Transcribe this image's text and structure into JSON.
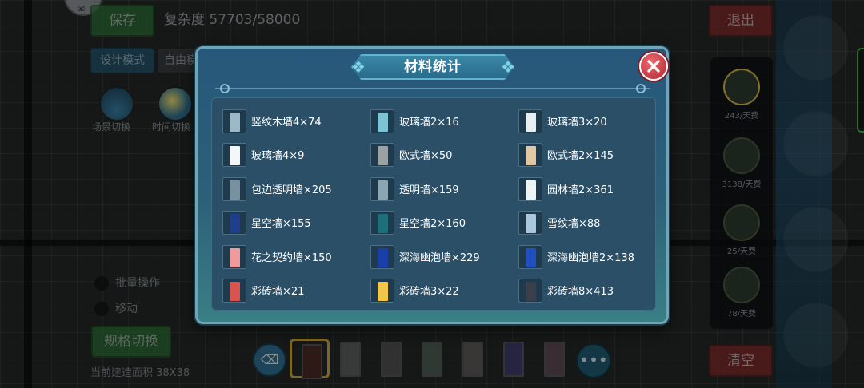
{
  "hud": {
    "save_label": "保存",
    "complexity_text": "复杂度 57703/58000",
    "design_mode_label": "设计模式",
    "free_mode_label": "自由模",
    "scene_switch_label": "场景切换",
    "time_switch_label": "时间切换",
    "batch_op_label": "批量操作",
    "move_label": "移动",
    "spec_switch_label": "规格切换",
    "area_text": "当前建造面积 38X38",
    "exit_label": "退出",
    "clear_label": "清空"
  },
  "side_panel": {
    "items": [
      {
        "label": "243/天费",
        "icon": "wall-tile-icon"
      },
      {
        "label": "3138/天费",
        "icon": "window-icon"
      },
      {
        "label": "25/天费",
        "icon": "door-icon"
      },
      {
        "label": "78/天费",
        "icon": "fence-icon"
      }
    ]
  },
  "toolbar": {
    "eraser_icon": "eraser-icon",
    "more_label": "•••",
    "doors": [
      {
        "color": "#4a2b24",
        "selected": true
      },
      {
        "color": "#5d5d5d",
        "selected": false
      },
      {
        "color": "#4f4f4f",
        "selected": false
      },
      {
        "color": "#4d5d55",
        "selected": false
      },
      {
        "color": "#5c5a58",
        "selected": false
      },
      {
        "color": "#3c3a6a",
        "selected": false
      },
      {
        "color": "#5a4a52",
        "selected": false
      }
    ]
  },
  "dialog": {
    "title": "材料统计",
    "close_icon": "close-icon",
    "materials": [
      {
        "label": "竖纹木墙4×74",
        "color": "#9cb9c8"
      },
      {
        "label": "玻璃墙2×16",
        "color": "#7cc3d6"
      },
      {
        "label": "玻璃墙3×20",
        "color": "#e9eef1"
      },
      {
        "label": "玻璃墙4×9",
        "color": "#f4f6f7"
      },
      {
        "label": "欧式墙×50",
        "color": "#9aa2a6"
      },
      {
        "label": "欧式墙2×145",
        "color": "#e3c7a3"
      },
      {
        "label": "包边透明墙×205",
        "color": "#7891a0"
      },
      {
        "label": "透明墙×159",
        "color": "#8aa6b3"
      },
      {
        "label": "园林墙2×361",
        "color": "#eef3f4"
      },
      {
        "label": "星空墙×155",
        "color": "#1f3f8c"
      },
      {
        "label": "星空墙2×160",
        "color": "#1d6f7a"
      },
      {
        "label": "雪纹墙×88",
        "color": "#a9c6dc"
      },
      {
        "label": "花之契约墙×150",
        "color": "#f19a9a"
      },
      {
        "label": "深海幽泡墙×229",
        "color": "#1a3fa6"
      },
      {
        "label": "深海幽泡墙2×138",
        "color": "#2050c0"
      },
      {
        "label": "彩砖墙×21",
        "color": "#d9534f"
      },
      {
        "label": "彩砖墙3×22",
        "color": "#f2c648"
      },
      {
        "label": "彩砖墙8×413",
        "color": "#3a3f4a"
      }
    ]
  }
}
